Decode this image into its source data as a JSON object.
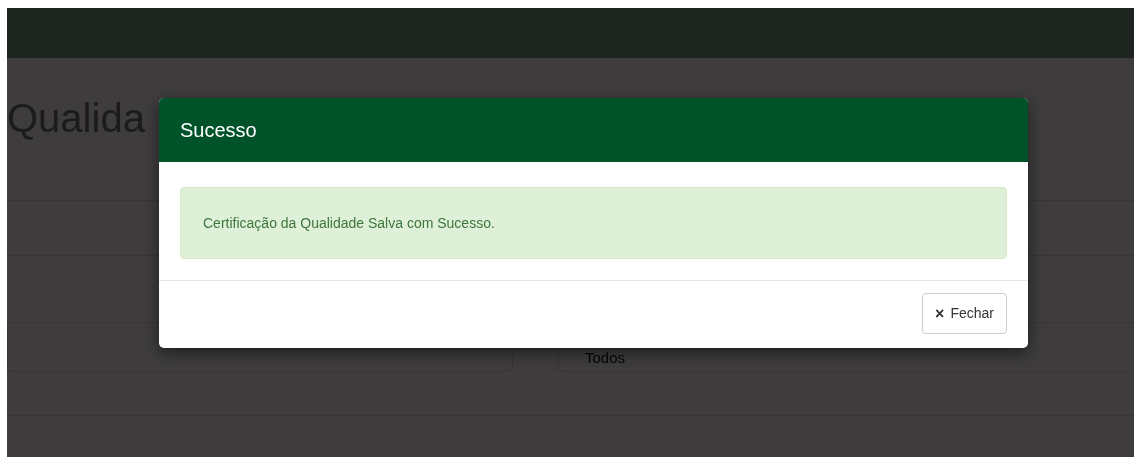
{
  "page": {
    "heading": "Qualida",
    "filter_value": "Todos"
  },
  "modal": {
    "title": "Sucesso",
    "message": "Certificação da Qualidade Salva com Sucesso.",
    "close_button": {
      "icon": "×",
      "label": "Fechar"
    }
  }
}
